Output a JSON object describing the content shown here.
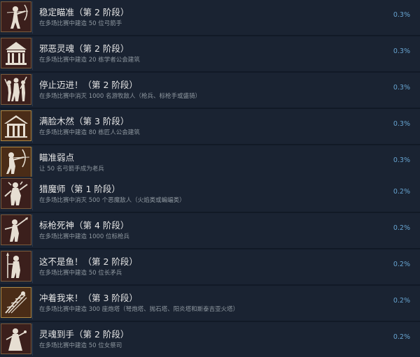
{
  "colors": {
    "background": "#111926",
    "row_background": "#1a2332",
    "title_text": "#e6e6e6",
    "description_text": "#8f98a0",
    "percent_text": "#67a4d1",
    "icon_frame_red": "#7a5a3b",
    "icon_frame_gold": "#b08a45",
    "icon_art": "#e6ded2"
  },
  "achievements": [
    {
      "icon": "archer-aiming-icon",
      "title": "稳定瞄准（第 2 阶段）",
      "description": "在多场比赛中建造 50 位弓箭手",
      "percent": "0.3%"
    },
    {
      "icon": "academy-building-icon",
      "title": "邪恶灵魂（第 2 阶段）",
      "description": "在多场比赛中建造 20 栋学者公会建筑",
      "percent": "0.3%"
    },
    {
      "icon": "warriors-group-icon",
      "title": "停止迈进！（第 2 阶段）",
      "description": "在多场比赛中消灭 1000 名游牧敌人（枪兵、标枪手或盛骑）",
      "percent": "0.3%"
    },
    {
      "icon": "workshop-building-icon",
      "title": "满脸木然（第 3 阶段）",
      "description": "在多场比赛中建造 80 栋匠人公会建筑",
      "percent": "0.3%"
    },
    {
      "icon": "archer-drawing-bow-icon",
      "title": "瞄准弱点",
      "description": "让 50 名弓箭手成为老兵",
      "percent": "0.3%"
    },
    {
      "icon": "demon-hunter-icon",
      "title": "猎魔师（第 1 阶段）",
      "description": "在多场比赛中消灭 500 个恶魔敌人（火焰类或蝙蝠类）",
      "percent": "0.2%"
    },
    {
      "icon": "javelin-thrower-icon",
      "title": "标枪死神（第 4 阶段）",
      "description": "在多场比赛中建造 1000 位标枪兵",
      "percent": "0.2%"
    },
    {
      "icon": "spearman-icon",
      "title": "这不是鱼！（第 2 阶段）",
      "description": "在多场比赛中建造 50 位长矛兵",
      "percent": "0.2%"
    },
    {
      "icon": "towers-attack-icon",
      "title": "冲着我来！（第 3 阶段）",
      "description": "在多场比赛中建造 300 座炮塔（弩炮塔、抛石塔、阳炎塔和斯泰吉亚火塔）",
      "percent": "0.2%"
    },
    {
      "icon": "priestess-icon",
      "title": "灵魂到手（第 2 阶段）",
      "description": "在多场比赛中建造 50 位女祭司",
      "percent": "0.2%"
    }
  ]
}
